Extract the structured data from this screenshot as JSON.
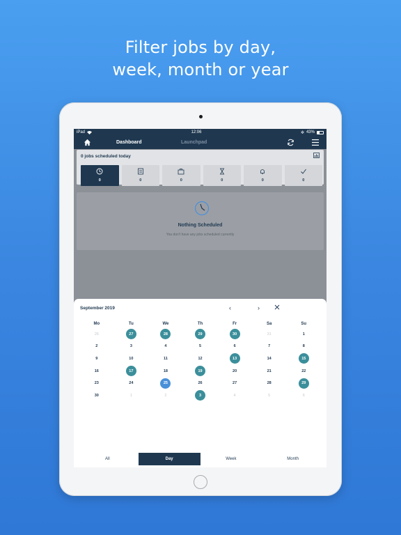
{
  "promo": {
    "line1": "Filter jobs by day,",
    "line2": "week, month or year"
  },
  "status_bar": {
    "carrier": "iPad",
    "time": "12:06",
    "battery": "43%"
  },
  "nav": {
    "dashboard": "Dashboard",
    "launchpad": "Launchpad",
    "icons": [
      "home-icon",
      "refresh-icon",
      "menu-icon"
    ]
  },
  "today": {
    "title": "0 jobs scheduled today",
    "tiles": [
      {
        "icon": "clock-icon",
        "count": "0",
        "active": true
      },
      {
        "icon": "list-icon",
        "count": "0"
      },
      {
        "icon": "briefcase-icon",
        "count": "0"
      },
      {
        "icon": "hourglass-icon",
        "count": "0"
      },
      {
        "icon": "bell-icon",
        "count": "0"
      },
      {
        "icon": "checkmark-icon",
        "count": "0"
      }
    ]
  },
  "empty_state": {
    "title": "Nothing Scheduled",
    "subtitle": "You don't have any jobs scheduled currently"
  },
  "calendar": {
    "month_label": "September 2019",
    "weekdays": [
      "Mo",
      "Tu",
      "We",
      "Th",
      "Fr",
      "Sa",
      "Su"
    ],
    "weeks": [
      [
        {
          "d": "26",
          "m": true
        },
        {
          "d": "27",
          "j": true
        },
        {
          "d": "28",
          "j": true
        },
        {
          "d": "29",
          "j": true
        },
        {
          "d": "30",
          "j": true
        },
        {
          "d": "31",
          "m": true
        },
        {
          "d": "1"
        }
      ],
      [
        {
          "d": "2"
        },
        {
          "d": "3"
        },
        {
          "d": "4"
        },
        {
          "d": "5"
        },
        {
          "d": "6"
        },
        {
          "d": "7"
        },
        {
          "d": "8"
        }
      ],
      [
        {
          "d": "9"
        },
        {
          "d": "10"
        },
        {
          "d": "11"
        },
        {
          "d": "12"
        },
        {
          "d": "13",
          "j": true
        },
        {
          "d": "14"
        },
        {
          "d": "15",
          "j": true
        }
      ],
      [
        {
          "d": "16"
        },
        {
          "d": "17",
          "j": true
        },
        {
          "d": "18"
        },
        {
          "d": "19",
          "j": true
        },
        {
          "d": "20"
        },
        {
          "d": "21"
        },
        {
          "d": "22"
        }
      ],
      [
        {
          "d": "23"
        },
        {
          "d": "24"
        },
        {
          "d": "25",
          "t": true
        },
        {
          "d": "26"
        },
        {
          "d": "27"
        },
        {
          "d": "28"
        },
        {
          "d": "29",
          "j": true
        }
      ],
      [
        {
          "d": "30"
        },
        {
          "d": "1",
          "m": true
        },
        {
          "d": "2",
          "m": true
        },
        {
          "d": "3",
          "j": true
        },
        {
          "d": "4",
          "m": true
        },
        {
          "d": "5",
          "m": true
        },
        {
          "d": "6",
          "m": true
        }
      ]
    ]
  },
  "filters": {
    "options": [
      "All",
      "Day",
      "Week",
      "Month"
    ],
    "selected": "Day"
  },
  "colors": {
    "navy": "#1f3850",
    "teal_job": "#3b8f9b",
    "today_blue": "#4a90d9",
    "background_blue": "#3a86e0"
  }
}
